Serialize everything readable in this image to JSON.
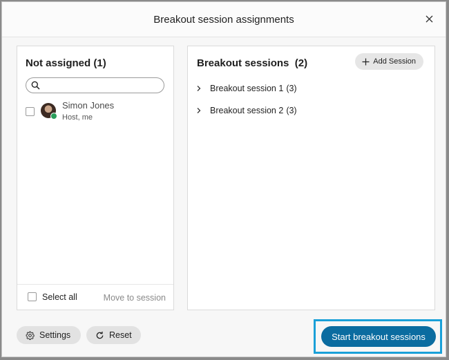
{
  "dialog": {
    "title": "Breakout session assignments"
  },
  "not_assigned": {
    "title": "Not assigned",
    "count_label": "(1)",
    "search": {
      "value": "",
      "placeholder": ""
    },
    "participants": [
      {
        "name": "Simon Jones",
        "role": "Host, me"
      }
    ],
    "select_all_label": "Select all",
    "move_to_label": "Move to session"
  },
  "breakout_sessions": {
    "title": "Breakout sessions",
    "count_label": "(2)",
    "add_label": "Add Session",
    "sessions": [
      {
        "name": "Breakout session 1",
        "count": "(3)"
      },
      {
        "name": "Breakout session 2",
        "count": "(3)"
      }
    ]
  },
  "footer": {
    "settings_label": "Settings",
    "reset_label": "Reset",
    "start_label": "Start breakout sessions"
  },
  "colors": {
    "primary_button": "#0b6ca0",
    "focus_outline": "#1aa0d8",
    "presence_available": "#2a9d5a"
  },
  "icons": {
    "close": "close-icon",
    "search": "search-icon",
    "expand": "chevron-right-icon",
    "add": "plus-icon",
    "settings": "gear-icon",
    "reset": "refresh-icon"
  }
}
